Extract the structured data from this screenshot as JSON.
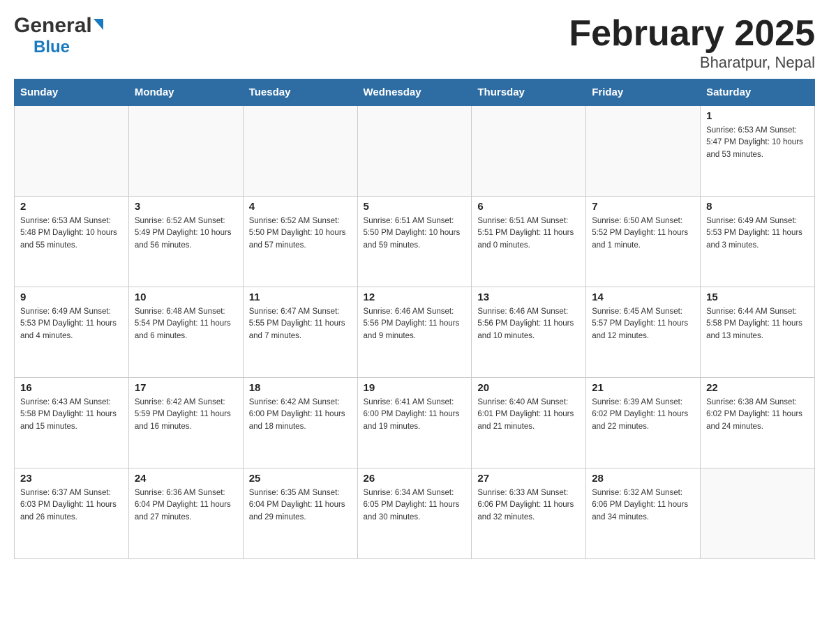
{
  "logo": {
    "general": "General",
    "blue": "Blue"
  },
  "title": "February 2025",
  "subtitle": "Bharatpur, Nepal",
  "days": [
    "Sunday",
    "Monday",
    "Tuesday",
    "Wednesday",
    "Thursday",
    "Friday",
    "Saturday"
  ],
  "weeks": [
    [
      {
        "day": "",
        "info": ""
      },
      {
        "day": "",
        "info": ""
      },
      {
        "day": "",
        "info": ""
      },
      {
        "day": "",
        "info": ""
      },
      {
        "day": "",
        "info": ""
      },
      {
        "day": "",
        "info": ""
      },
      {
        "day": "1",
        "info": "Sunrise: 6:53 AM\nSunset: 5:47 PM\nDaylight: 10 hours\nand 53 minutes."
      }
    ],
    [
      {
        "day": "2",
        "info": "Sunrise: 6:53 AM\nSunset: 5:48 PM\nDaylight: 10 hours\nand 55 minutes."
      },
      {
        "day": "3",
        "info": "Sunrise: 6:52 AM\nSunset: 5:49 PM\nDaylight: 10 hours\nand 56 minutes."
      },
      {
        "day": "4",
        "info": "Sunrise: 6:52 AM\nSunset: 5:50 PM\nDaylight: 10 hours\nand 57 minutes."
      },
      {
        "day": "5",
        "info": "Sunrise: 6:51 AM\nSunset: 5:50 PM\nDaylight: 10 hours\nand 59 minutes."
      },
      {
        "day": "6",
        "info": "Sunrise: 6:51 AM\nSunset: 5:51 PM\nDaylight: 11 hours\nand 0 minutes."
      },
      {
        "day": "7",
        "info": "Sunrise: 6:50 AM\nSunset: 5:52 PM\nDaylight: 11 hours\nand 1 minute."
      },
      {
        "day": "8",
        "info": "Sunrise: 6:49 AM\nSunset: 5:53 PM\nDaylight: 11 hours\nand 3 minutes."
      }
    ],
    [
      {
        "day": "9",
        "info": "Sunrise: 6:49 AM\nSunset: 5:53 PM\nDaylight: 11 hours\nand 4 minutes."
      },
      {
        "day": "10",
        "info": "Sunrise: 6:48 AM\nSunset: 5:54 PM\nDaylight: 11 hours\nand 6 minutes."
      },
      {
        "day": "11",
        "info": "Sunrise: 6:47 AM\nSunset: 5:55 PM\nDaylight: 11 hours\nand 7 minutes."
      },
      {
        "day": "12",
        "info": "Sunrise: 6:46 AM\nSunset: 5:56 PM\nDaylight: 11 hours\nand 9 minutes."
      },
      {
        "day": "13",
        "info": "Sunrise: 6:46 AM\nSunset: 5:56 PM\nDaylight: 11 hours\nand 10 minutes."
      },
      {
        "day": "14",
        "info": "Sunrise: 6:45 AM\nSunset: 5:57 PM\nDaylight: 11 hours\nand 12 minutes."
      },
      {
        "day": "15",
        "info": "Sunrise: 6:44 AM\nSunset: 5:58 PM\nDaylight: 11 hours\nand 13 minutes."
      }
    ],
    [
      {
        "day": "16",
        "info": "Sunrise: 6:43 AM\nSunset: 5:58 PM\nDaylight: 11 hours\nand 15 minutes."
      },
      {
        "day": "17",
        "info": "Sunrise: 6:42 AM\nSunset: 5:59 PM\nDaylight: 11 hours\nand 16 minutes."
      },
      {
        "day": "18",
        "info": "Sunrise: 6:42 AM\nSunset: 6:00 PM\nDaylight: 11 hours\nand 18 minutes."
      },
      {
        "day": "19",
        "info": "Sunrise: 6:41 AM\nSunset: 6:00 PM\nDaylight: 11 hours\nand 19 minutes."
      },
      {
        "day": "20",
        "info": "Sunrise: 6:40 AM\nSunset: 6:01 PM\nDaylight: 11 hours\nand 21 minutes."
      },
      {
        "day": "21",
        "info": "Sunrise: 6:39 AM\nSunset: 6:02 PM\nDaylight: 11 hours\nand 22 minutes."
      },
      {
        "day": "22",
        "info": "Sunrise: 6:38 AM\nSunset: 6:02 PM\nDaylight: 11 hours\nand 24 minutes."
      }
    ],
    [
      {
        "day": "23",
        "info": "Sunrise: 6:37 AM\nSunset: 6:03 PM\nDaylight: 11 hours\nand 26 minutes."
      },
      {
        "day": "24",
        "info": "Sunrise: 6:36 AM\nSunset: 6:04 PM\nDaylight: 11 hours\nand 27 minutes."
      },
      {
        "day": "25",
        "info": "Sunrise: 6:35 AM\nSunset: 6:04 PM\nDaylight: 11 hours\nand 29 minutes."
      },
      {
        "day": "26",
        "info": "Sunrise: 6:34 AM\nSunset: 6:05 PM\nDaylight: 11 hours\nand 30 minutes."
      },
      {
        "day": "27",
        "info": "Sunrise: 6:33 AM\nSunset: 6:06 PM\nDaylight: 11 hours\nand 32 minutes."
      },
      {
        "day": "28",
        "info": "Sunrise: 6:32 AM\nSunset: 6:06 PM\nDaylight: 11 hours\nand 34 minutes."
      },
      {
        "day": "",
        "info": ""
      }
    ]
  ]
}
